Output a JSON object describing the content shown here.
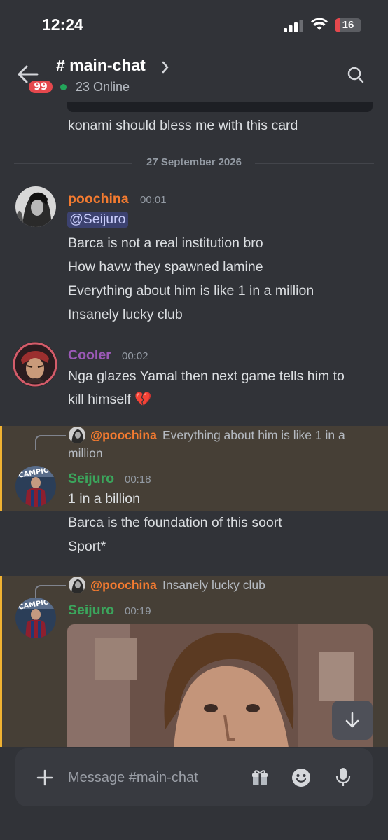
{
  "status_bar": {
    "time": "12:24",
    "battery": "16"
  },
  "header": {
    "unread_count": "99",
    "channel_name": "# main-chat",
    "online": "23 Online"
  },
  "messages": {
    "prev_text": "konami should bless me with this card",
    "date_divider": "27 September 2026",
    "msg1": {
      "username": "poochina",
      "time": "00:01",
      "mention": "@Seijuro",
      "lines": [
        "Barca is not a real institution bro",
        "How havw they spawned lamine",
        "Everything about him is like 1 in a million",
        "Insanely lucky club"
      ]
    },
    "msg2": {
      "username": "Cooler",
      "time": "00:02",
      "lines": [
        "Nga glazes Yamal then next game tells him to",
        "kill himself 💔"
      ]
    },
    "msg3": {
      "reply_name": "@poochina",
      "reply_text_1": "Everything about him is like 1 in a",
      "reply_text_2": "million",
      "username": "Seijuro",
      "time": "00:18",
      "lines": [
        "1 in a billion",
        "Barca is the foundation of this soort",
        "Sport*"
      ]
    },
    "msg4": {
      "reply_name": "@poochina",
      "reply_text": "Insanely lucky club",
      "username": "Seijuro",
      "time": "00:19"
    }
  },
  "composer": {
    "placeholder": "Message #main-chat"
  },
  "colors": {
    "poochina": "#f47b30",
    "cooler": "#9b59b6",
    "seijuro": "#3ba55c",
    "highlight": "#463f36",
    "highlight_bar": "#f0b232"
  },
  "icons": [
    "back-arrow-icon",
    "chevron-right-icon",
    "search-icon",
    "arrow-down-icon",
    "plus-icon",
    "gift-icon",
    "emoji-icon",
    "microphone-icon"
  ]
}
